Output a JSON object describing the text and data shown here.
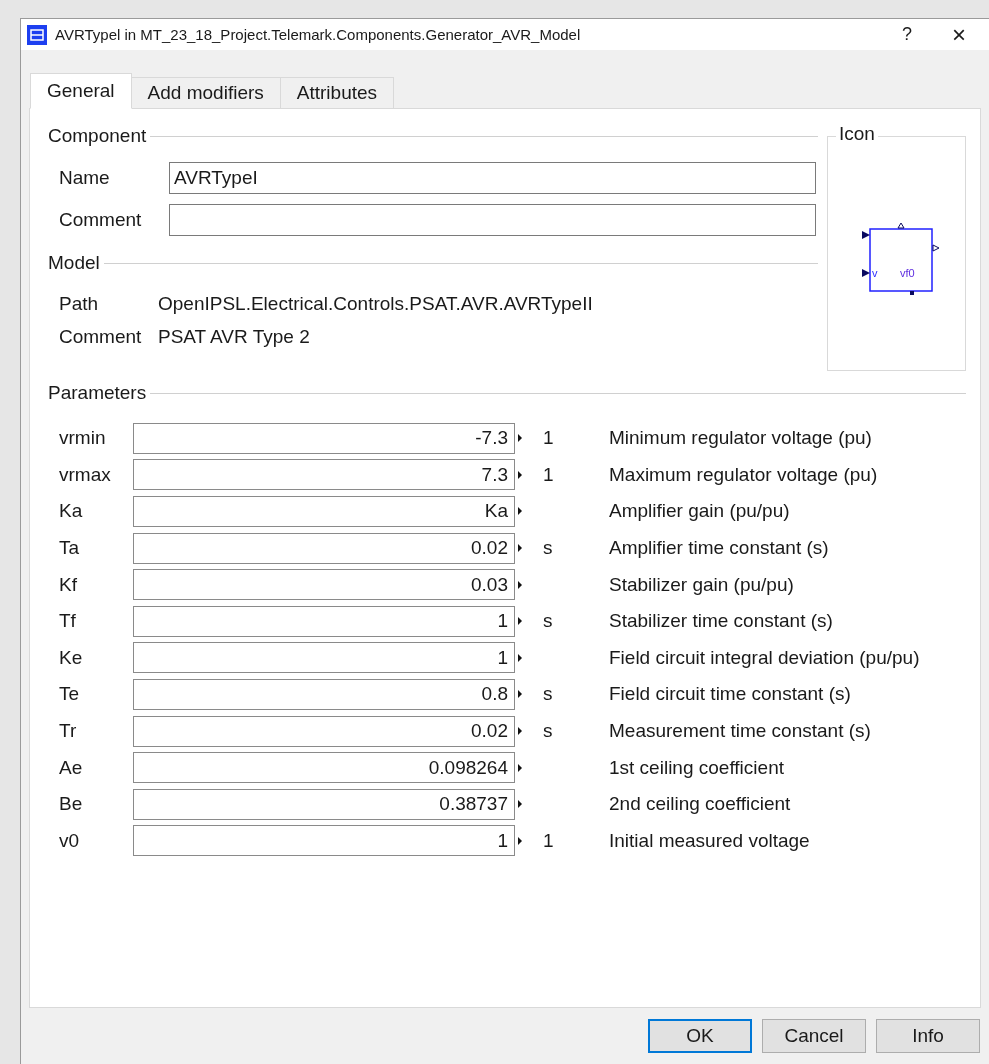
{
  "window": {
    "title": "AVRTypel in MT_23_18_Project.Telemark.Components.Generator_AVR_Model",
    "help": "?",
    "close": "×"
  },
  "tabs": [
    {
      "label": "General",
      "selected": true
    },
    {
      "label": "Add modifiers",
      "selected": false
    },
    {
      "label": "Attributes",
      "selected": false
    }
  ],
  "component": {
    "legend": "Component",
    "fields": [
      {
        "label": "Name",
        "value": "AVRTypeI"
      },
      {
        "label": "Comment"
      }
    ]
  },
  "model": {
    "legend": "Model",
    "rows": [
      {
        "label": "Path",
        "value": "OpenIPSL.Electrical.Controls.PSAT.AVR.AVRTypeII"
      },
      {
        "label": "Comment",
        "value": "PSAT AVR Type 2"
      }
    ]
  },
  "icon": {
    "legend": "Icon",
    "input_label": "v",
    "output_label": "vf0"
  },
  "parameters": {
    "legend": "Parameters",
    "rows": [
      {
        "name": "vrmin",
        "value": "-7.3",
        "unit": "1",
        "description": "Minimum regulator voltage (pu)"
      },
      {
        "name": "vrmax",
        "value": "7.3",
        "unit": "1",
        "description": "Maximum regulator voltage (pu)"
      },
      {
        "name": "Ka",
        "value": "Ka",
        "description": "Amplifier gain (pu/pu)"
      },
      {
        "name": "Ta",
        "value": "0.02",
        "unit": "s",
        "description": "Amplifier time constant (s)"
      },
      {
        "name": "Kf",
        "value": "0.03",
        "description": "Stabilizer gain (pu/pu)"
      },
      {
        "name": "Tf",
        "value": "1",
        "unit": "s",
        "description": "Stabilizer time constant (s)"
      },
      {
        "name": "Ke",
        "value": "1",
        "description": "Field circuit integral deviation (pu/pu)"
      },
      {
        "name": "Te",
        "value": "0.8",
        "unit": "s",
        "description": "Field circuit time constant (s)"
      },
      {
        "name": "Tr",
        "value": "0.02",
        "unit": "s",
        "description": "Measurement time constant (s)"
      },
      {
        "name": "Ae",
        "value": "0.098264",
        "description": "1st ceiling coefficient"
      },
      {
        "name": "Be",
        "value": "0.38737",
        "description": "2nd ceiling coefficient"
      },
      {
        "name": "v0",
        "value": "1",
        "unit": "1",
        "description": "Initial measured voltage"
      }
    ]
  },
  "buttons": [
    {
      "label": "OK",
      "default": true
    },
    {
      "label": "Cancel",
      "default": false
    },
    {
      "label": "Info",
      "default": false
    }
  ]
}
